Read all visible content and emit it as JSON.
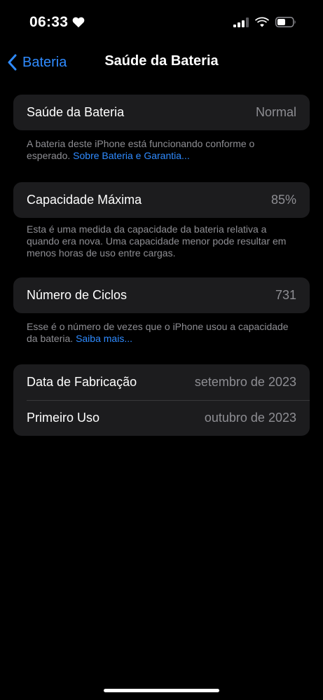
{
  "status_bar": {
    "time": "06:33"
  },
  "nav": {
    "back_label": "Bateria",
    "title": "Saúde da Bateria"
  },
  "health": {
    "label": "Saúde da Bateria",
    "value": "Normal",
    "footer_text": "A bateria deste iPhone está funcionando conforme o esperado. ",
    "footer_link": "Sobre Bateria e Garantia..."
  },
  "capacity": {
    "label": "Capacidade Máxima",
    "value": "85%",
    "footer_text": "Esta é uma medida da capacidade da bateria relativa a quando era nova. Uma capacidade menor pode resultar em menos horas de uso entre cargas."
  },
  "cycles": {
    "label": "Número de Ciclos",
    "value": "731",
    "footer_text": "Esse é o número de vezes que o iPhone usou a capacidade da bateria. ",
    "footer_link": "Saiba mais..."
  },
  "dates": {
    "manufacture_label": "Data de Fabricação",
    "manufacture_value": "setembro de 2023",
    "first_use_label": "Primeiro Uso",
    "first_use_value": "outubro de 2023"
  },
  "colors": {
    "background": "#000000",
    "cell": "#1c1c1e",
    "accent": "#2f8bff",
    "secondary_text": "#8e8e93"
  },
  "icons": [
    "heart-icon",
    "signal-icon",
    "wifi-icon",
    "battery-icon",
    "back-chevron-icon"
  ]
}
